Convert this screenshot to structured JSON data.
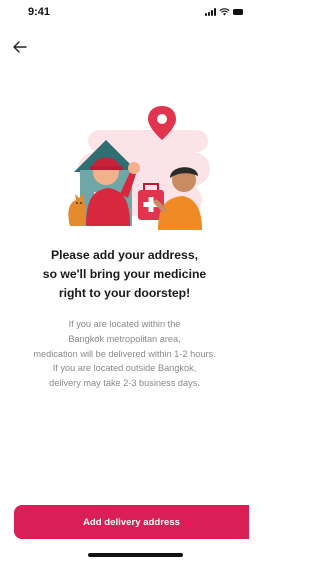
{
  "status_bar": {
    "time": "9:41"
  },
  "content": {
    "headline_lines": [
      "Please add your address,",
      "so we'll bring your medicine",
      "right to your doorstep!"
    ],
    "info_inside_lines": [
      "If you are located within the",
      "Bangkok metropolitan area,",
      "medication will be delivered within 1-2 hours."
    ],
    "info_outside_lines": [
      "If you are located outside Bangkok,",
      "delivery may take 2-3 business days."
    ]
  },
  "actions": {
    "add_address_label": "Add delivery address"
  },
  "colors": {
    "accent": "#d91f55",
    "illustration_bg": "#fbe3e8",
    "house_teal": "#2f6f74",
    "courier_red": "#d7283f",
    "receiver_orange": "#f08a24"
  },
  "icons": [
    "back-arrow-icon",
    "signal-icon",
    "wifi-icon",
    "battery-icon",
    "location-pin-icon"
  ]
}
